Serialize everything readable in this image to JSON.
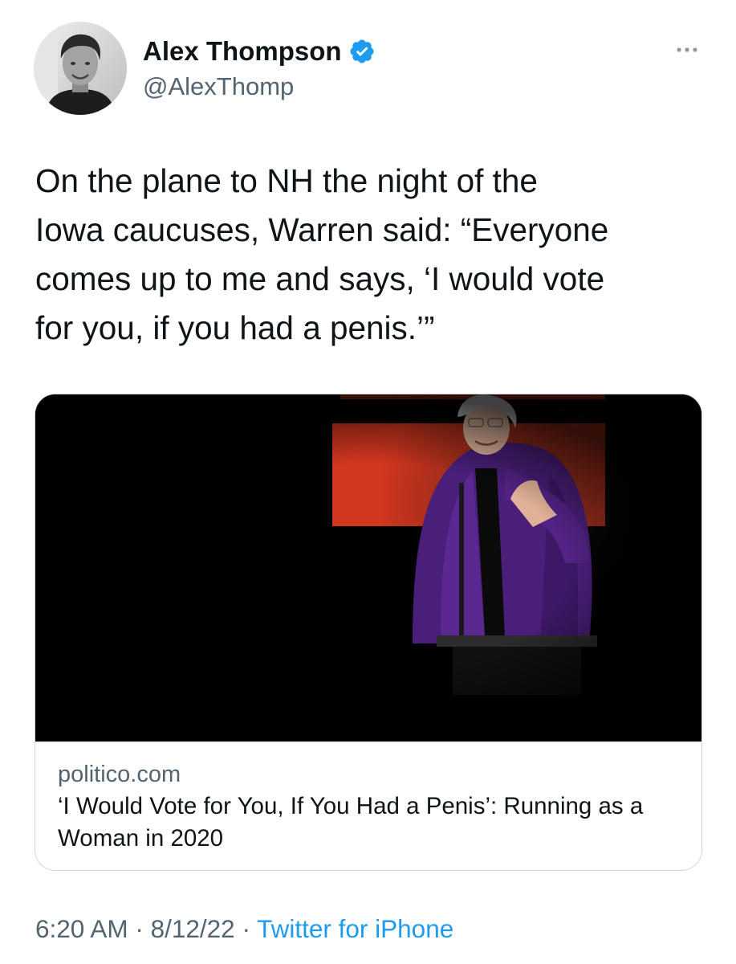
{
  "author": {
    "display_name": "Alex Thompson",
    "handle": "@AlexThomp",
    "verified": true
  },
  "tweet": {
    "text": "On the plane to NH the night of the\nIowa caucuses, Warren said: “Everyone\ncomes up to me and says, ‘I would vote\nfor you, if you had a penis.’”"
  },
  "link_card": {
    "domain": "politico.com",
    "title": "‘I Would Vote for You, If You Had a Penis’: Running as a Woman in 2020"
  },
  "meta": {
    "time": "6:20 AM",
    "separator_1": " · ",
    "date": "8/12/22",
    "separator_2": " · ",
    "source": "Twitter for iPhone"
  },
  "colors": {
    "text_primary": "#0f1419",
    "text_secondary": "#536471",
    "link": "#1d9bf0",
    "verified_badge": "#1d9bf0",
    "card_border": "#cfd9de"
  },
  "icons": {
    "verified": "verified-badge-icon",
    "more": "more-options-icon"
  }
}
